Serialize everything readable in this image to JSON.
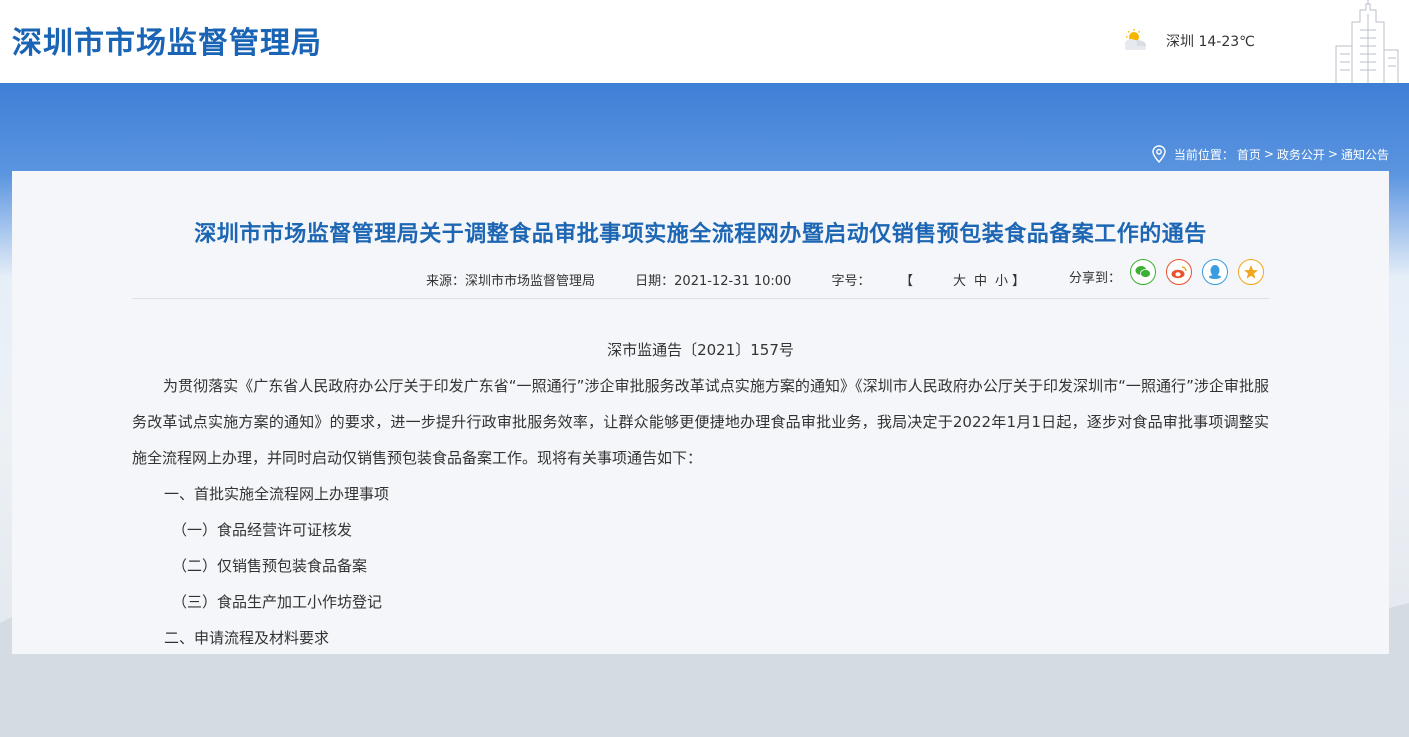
{
  "header": {
    "logo": "深圳市市场监督管理局",
    "weather": "深圳 14-23℃",
    "weather_icon": "partly-cloudy-icon"
  },
  "breadcrumb": {
    "label": "当前位置：",
    "items": [
      "首页",
      "政务公开",
      "通知公告"
    ],
    "separator": ">"
  },
  "article": {
    "title": "深圳市市场监督管理局关于调整食品审批事项实施全流程网办暨启动仅销售预包装食品备案工作的通告",
    "source": "来源：深圳市市场监督管理局",
    "date": "日期：2021-12-31 10:00",
    "font_size_label": "字号：",
    "font_bracket_open": "【",
    "font_sizes": [
      "大",
      "中",
      "小"
    ],
    "font_bracket_close": "】",
    "share_label": "分享到：",
    "share_icons": [
      "wechat-icon",
      "weibo-icon",
      "qq-icon",
      "qzone-icon"
    ],
    "doc_no": "深市监通告〔2021〕157号",
    "intro": "为贯彻落实《广东省人民政府办公厅关于印发广东省“一照通行”涉企审批服务改革试点实施方案的通知》《深圳市人民政府办公厅关于印发深圳市“一照通行”涉企审批服务改革试点实施方案的通知》的要求，进一步提升行政审批服务效率，让群众能够更便捷地办理食品审批业务，我局决定于2022年1月1日起，逐步对食品审批事项调整实施全流程网上办理，并同时启动仅销售预包装食品备案工作。现将有关事项通告如下：",
    "section1": "一、首批实施全流程网上办理事项",
    "item1": "（一）食品经营许可证核发",
    "item2": "（二）仅销售预包装食品备案",
    "item3": "（三）食品生产加工小作坊登记",
    "section2": "二、申请流程及材料要求"
  },
  "colors": {
    "brand_blue": "#1a64b5",
    "title_blue": "#1d66b3",
    "wechat": "#3cb034",
    "weibo": "#e8542f",
    "qq": "#3a9ce0",
    "qzone": "#f2a51e"
  }
}
